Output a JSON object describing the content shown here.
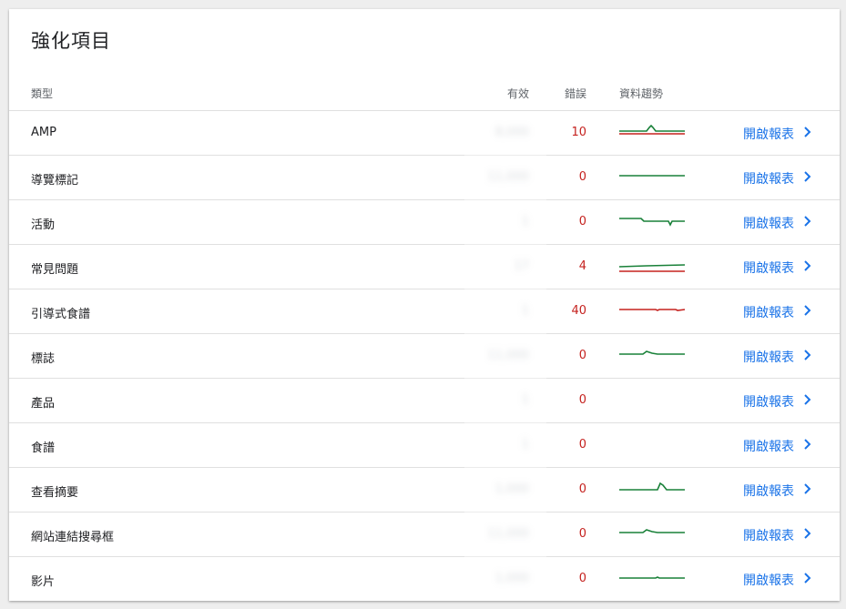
{
  "card": {
    "title": "強化項目"
  },
  "header": {
    "type": "類型",
    "valid": "有效",
    "errors": "錯誤",
    "trend": "資料趨勢"
  },
  "colors": {
    "valid_line": "#188038",
    "error_line": "#c5221f",
    "link": "#1a73e8"
  },
  "rows": [
    {
      "name": "AMP",
      "valid": "8,000",
      "errors": "10",
      "link": "開啟報表",
      "trend": "amp"
    },
    {
      "name": "導覽標記",
      "valid": "11,000",
      "errors": "0",
      "link": "開啟報表",
      "trend": "flat"
    },
    {
      "name": "活動",
      "valid": "1",
      "errors": "0",
      "link": "開啟報表",
      "trend": "event"
    },
    {
      "name": "常見問題",
      "valid": "17",
      "errors": "4",
      "link": "開啟報表",
      "trend": "faq"
    },
    {
      "name": "引導式食譜",
      "valid": "1",
      "errors": "40",
      "link": "開啟報表",
      "trend": "guided"
    },
    {
      "name": "標誌",
      "valid": "11,000",
      "errors": "0",
      "link": "開啟報表",
      "trend": "bump"
    },
    {
      "name": "產品",
      "valid": "1",
      "errors": "0",
      "link": "開啟報表",
      "trend": "none"
    },
    {
      "name": "食譜",
      "valid": "1",
      "errors": "0",
      "link": "開啟報表",
      "trend": "none"
    },
    {
      "name": "查看摘要",
      "valid": "1,000",
      "errors": "0",
      "link": "開啟報表",
      "trend": "spike"
    },
    {
      "name": "網站連結搜尋框",
      "valid": "11,000",
      "errors": "0",
      "link": "開啟報表",
      "trend": "bump"
    },
    {
      "name": "影片",
      "valid": "1,000",
      "errors": "0",
      "link": "開啟報表",
      "trend": "flat2"
    }
  ]
}
